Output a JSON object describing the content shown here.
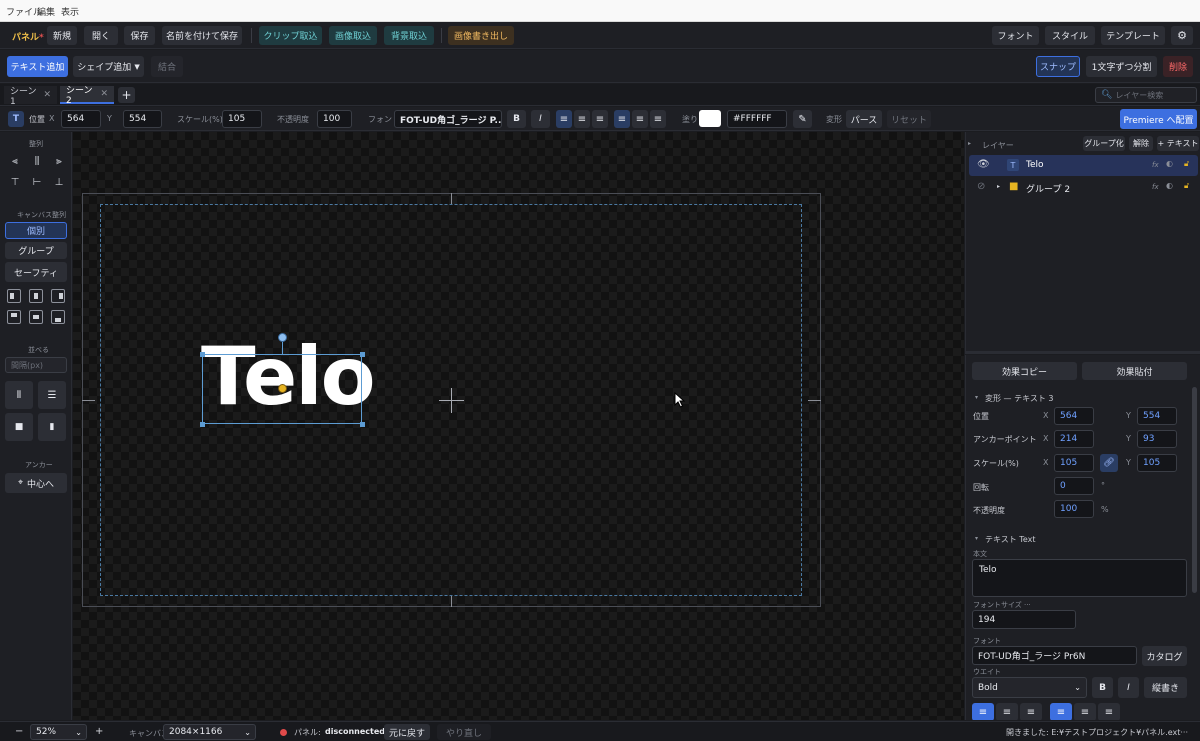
{
  "menu": [
    "ファイル",
    "編集",
    "表示"
  ],
  "toolbar": {
    "panel_label": "パネル",
    "panel_mark": "*",
    "new": "新規",
    "open": "開く",
    "save": "保存",
    "save_as": "名前を付けて保存",
    "clip_import": "クリップ取込",
    "image_import": "画像取込",
    "bg_import": "背景取込",
    "image_export": "画像書き出し",
    "font": "フォント",
    "style": "スタイル",
    "template": "テンプレート"
  },
  "toolbar2": {
    "add_text": "テキスト追加",
    "add_shape": "シェイプ追加",
    "combine": "結合",
    "snap": "スナップ",
    "split_chars": "1文字ずつ分割",
    "delete": "削除"
  },
  "scenes": {
    "tabs": [
      "シーン1",
      "シーン2"
    ],
    "active": 1,
    "layer_search_placeholder": "レイヤー検索"
  },
  "props": {
    "type_icon": "T",
    "pos_label": "位置",
    "x_label": "X",
    "x": "564",
    "y_label": "Y",
    "y": "554",
    "scale_label": "スケール(%)",
    "scale": "105",
    "opacity_label": "不透明度",
    "opacity": "100",
    "font_label": "フォント",
    "font_value": "FOT-UD角ゴ_ラージ P...",
    "bold": "B",
    "italic": "I",
    "fill_label": "塗り",
    "fill_color": "#FFFFFF",
    "fill_hex": "#FFFFFF",
    "transform_label": "変形",
    "perspective": "パース",
    "reset": "リセット",
    "premiere": "Premiere へ配置"
  },
  "left": {
    "align_title": "整列",
    "canvas_align_title": "キャンバス整列",
    "individual": "個別",
    "group": "グループ",
    "safety": "セーフティ",
    "arrange_title": "並べる",
    "spacing_placeholder": "間隔(px)",
    "anchor_title": "アンカー",
    "center": "中心へ"
  },
  "canvas": {
    "text": "Telo"
  },
  "layers": {
    "title": "レイヤー",
    "group_btn": "グループ化",
    "ungroup_btn": "解除",
    "add_text_btn": "+ テキスト",
    "items": [
      {
        "type": "T",
        "name": "Telo",
        "fx": "fx"
      },
      {
        "type": "folder",
        "name": "グループ 2",
        "fx": "fx"
      }
    ]
  },
  "effects": {
    "copy": "効果コピー",
    "paste": "効果貼付"
  },
  "transform": {
    "title": "変形 — テキスト 3",
    "position": "位置",
    "pos_x": "564",
    "pos_y": "554",
    "anchor": "アンカーポイント",
    "anchor_x": "214",
    "anchor_y": "93",
    "scale": "スケール(%)",
    "scale_x": "105",
    "scale_y": "105",
    "rotation": "回転",
    "rotation_val": "0",
    "rotation_unit": "°",
    "opacity": "不透明度",
    "opacity_val": "100",
    "opacity_unit": "%",
    "x": "X",
    "y": "Y"
  },
  "text_section": {
    "title": "テキスト Text",
    "body_label": "本文",
    "body": "Telo",
    "font_size_label": "フォントサイズ ···",
    "font_size": "194",
    "font_label": "フォント",
    "font": "FOT-UD角ゴ_ラージ Pr6N",
    "catalog": "カタログ",
    "weight_label": "ウエイト",
    "weight": "Bold",
    "bold": "B",
    "italic": "I",
    "vertical": "縦書き"
  },
  "status": {
    "minus": "−",
    "zoom": "52%",
    "plus": "+",
    "canvas_label": "キャンバス",
    "canvas_size": "2084×1166",
    "panel_label": "パネル:",
    "panel_status": "disconnected",
    "undo": "元に戻す",
    "redo": "やり直し",
    "opened": "開きました: E:¥テストプロジェクト¥パネル.ext···"
  },
  "colors": {
    "accent": "#3d6fe0",
    "teal_bg": "#1f3b40",
    "teal_text": "#6fd0d4",
    "orange_bg": "#3d3020",
    "orange_text": "#f0b860",
    "delete_text": "#ff6a6a",
    "lock": "#e6b422",
    "guide": "#5d9cd3"
  }
}
